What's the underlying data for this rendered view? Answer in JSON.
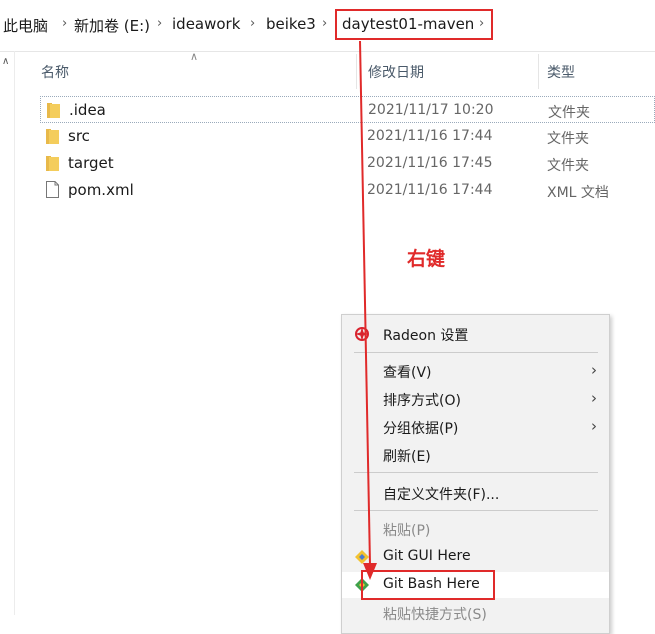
{
  "breadcrumb": {
    "items": [
      "此电脑",
      "新加卷 (E:)",
      "ideawork",
      "beike3",
      "daytest01-maven"
    ]
  },
  "columns": {
    "name": "名称",
    "modified": "修改日期",
    "type": "类型"
  },
  "files": [
    {
      "name": ".idea",
      "modified": "2021/11/17 10:20",
      "type": "文件夹",
      "icon": "folder-icon"
    },
    {
      "name": "src",
      "modified": "2021/11/16 17:44",
      "type": "文件夹",
      "icon": "folder-icon"
    },
    {
      "name": "target",
      "modified": "2021/11/16 17:45",
      "type": "文件夹",
      "icon": "folder-icon"
    },
    {
      "name": "pom.xml",
      "modified": "2021/11/16 17:44",
      "type": "XML 文档",
      "icon": "file-icon"
    }
  ],
  "annotation": {
    "text": "右键",
    "color": "#e02a2a"
  },
  "context_menu": {
    "radeon": "Radeon 设置",
    "view": "查看(V)",
    "sort": "排序方式(O)",
    "group": "分组依据(P)",
    "refresh": "刷新(E)",
    "customize": "自定义文件夹(F)...",
    "paste": "粘贴(P)",
    "git_gui": "Git GUI Here",
    "git_bash": "Git Bash Here",
    "paste_shortcut": "粘贴快捷方式(S)"
  }
}
